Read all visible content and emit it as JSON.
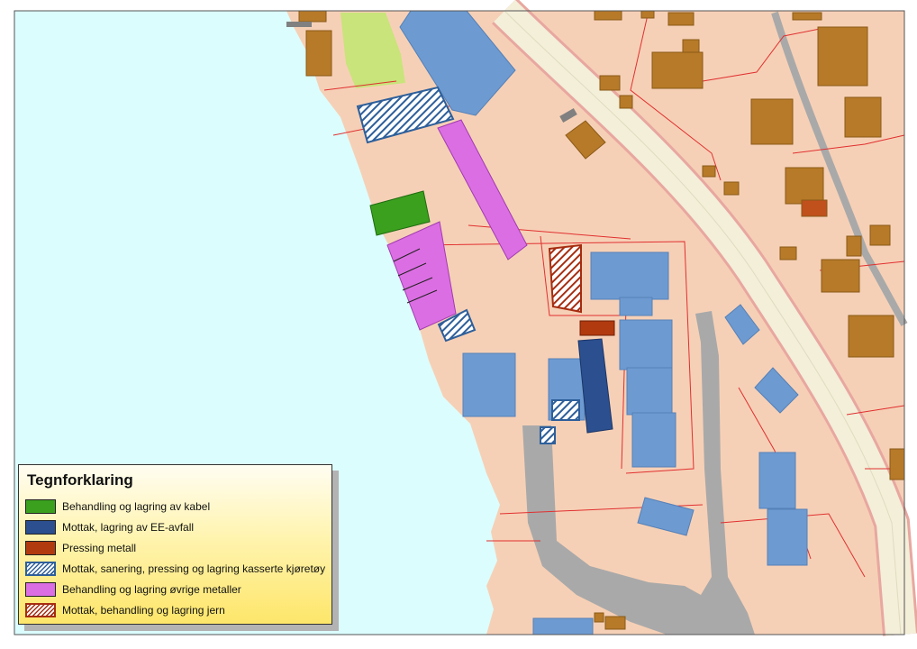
{
  "legend": {
    "title": "Tegnforklaring",
    "items": [
      {
        "label": "Behandling og lagring av kabel",
        "color": "#3aa01e",
        "pattern": "solid"
      },
      {
        "label": "Mottak, lagring av EE-avfall",
        "color": "#2b4f8f",
        "pattern": "solid"
      },
      {
        "label": "Pressing metall",
        "color": "#b23a0f",
        "pattern": "solid"
      },
      {
        "label": "Mottak, sanering, pressing og lagring kasserte kjøretøy",
        "color": "#2e5f9a",
        "pattern": "hatch"
      },
      {
        "label": "Behandling og lagring øvrige metaller",
        "color": "#dc6ee3",
        "pattern": "solid"
      },
      {
        "label": "Mottak, behandling og lagring jern",
        "color": "#a62c10",
        "pattern": "hatch"
      }
    ]
  },
  "colors": {
    "sea": "#dcfdfd",
    "land": "#f6d0b6",
    "building": "#6d9bd1",
    "house": "#b77a28",
    "road": "#a9a9a9",
    "parcel_line": "#e03030",
    "vegetation": "#c8e47a",
    "main_road": "#f3efd9"
  }
}
